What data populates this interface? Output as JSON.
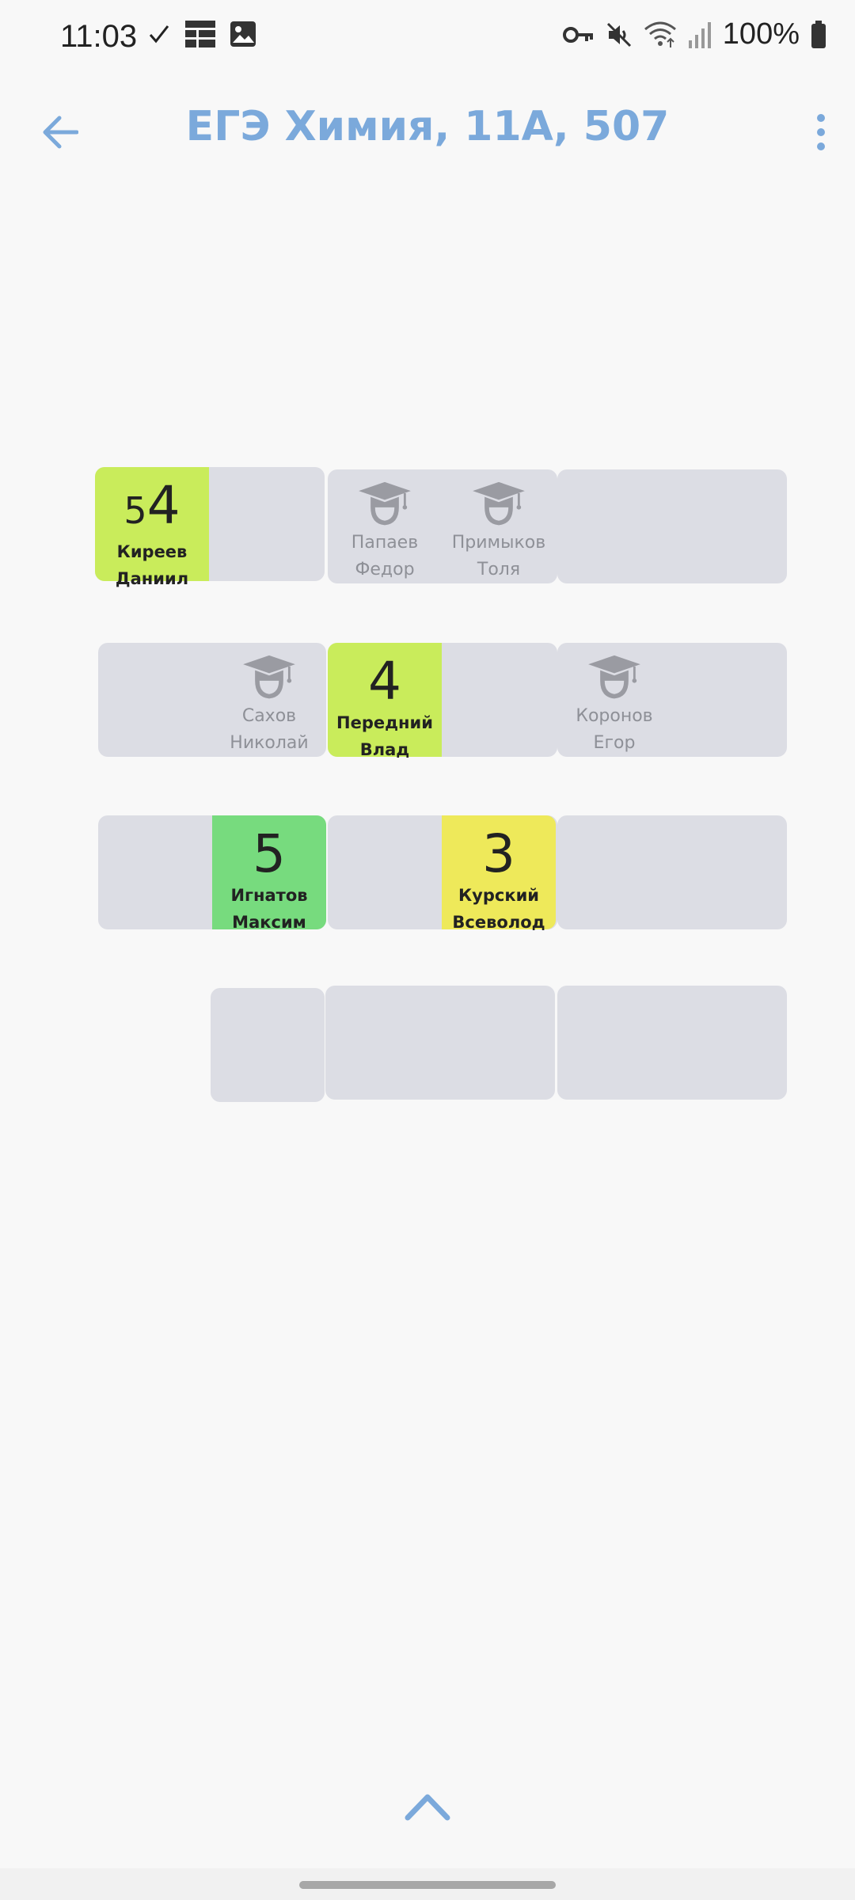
{
  "status_bar": {
    "time": "11:03",
    "battery": "100%",
    "icons_left": [
      "check-icon",
      "grid-icon",
      "image-icon"
    ],
    "icons_right": [
      "key-icon",
      "mute-icon",
      "wifi-icon",
      "signal-icon",
      "battery-icon"
    ]
  },
  "app_bar": {
    "title": "ЕГЭ Химия, 11А, 507",
    "accent_color": "#7BA9DB"
  },
  "seats": {
    "r1d1s1": {
      "grade_lead": "5",
      "grade": "4",
      "last": "Киреев",
      "first": "Даниил",
      "color": "#C9EC5B"
    },
    "r1d2s1": {
      "last": "Папаев",
      "first": "Федор"
    },
    "r1d2s2": {
      "last": "Примыков",
      "first": "Толя"
    },
    "r2d1s2": {
      "last": "Сахов",
      "first": "Николай"
    },
    "r2d2s1": {
      "grade": "4",
      "last": "Передний",
      "first": "Влад",
      "color": "#C9EC5B"
    },
    "r2d3s1": {
      "last": "Коронов",
      "first": "Егор"
    },
    "r3d1s2": {
      "grade": "5",
      "last": "Игнатов",
      "first": "Максим",
      "color": "#77DB7E"
    },
    "r3d2s2": {
      "grade": "3",
      "last": "Курский",
      "first": "Всеволод",
      "color": "#EEE95A"
    }
  },
  "colors": {
    "desk": "#DCDDE4",
    "grade_4": "#C9EC5B",
    "grade_5": "#77DB7E",
    "grade_3": "#EEE95A",
    "absent_text": "#8E9097"
  }
}
